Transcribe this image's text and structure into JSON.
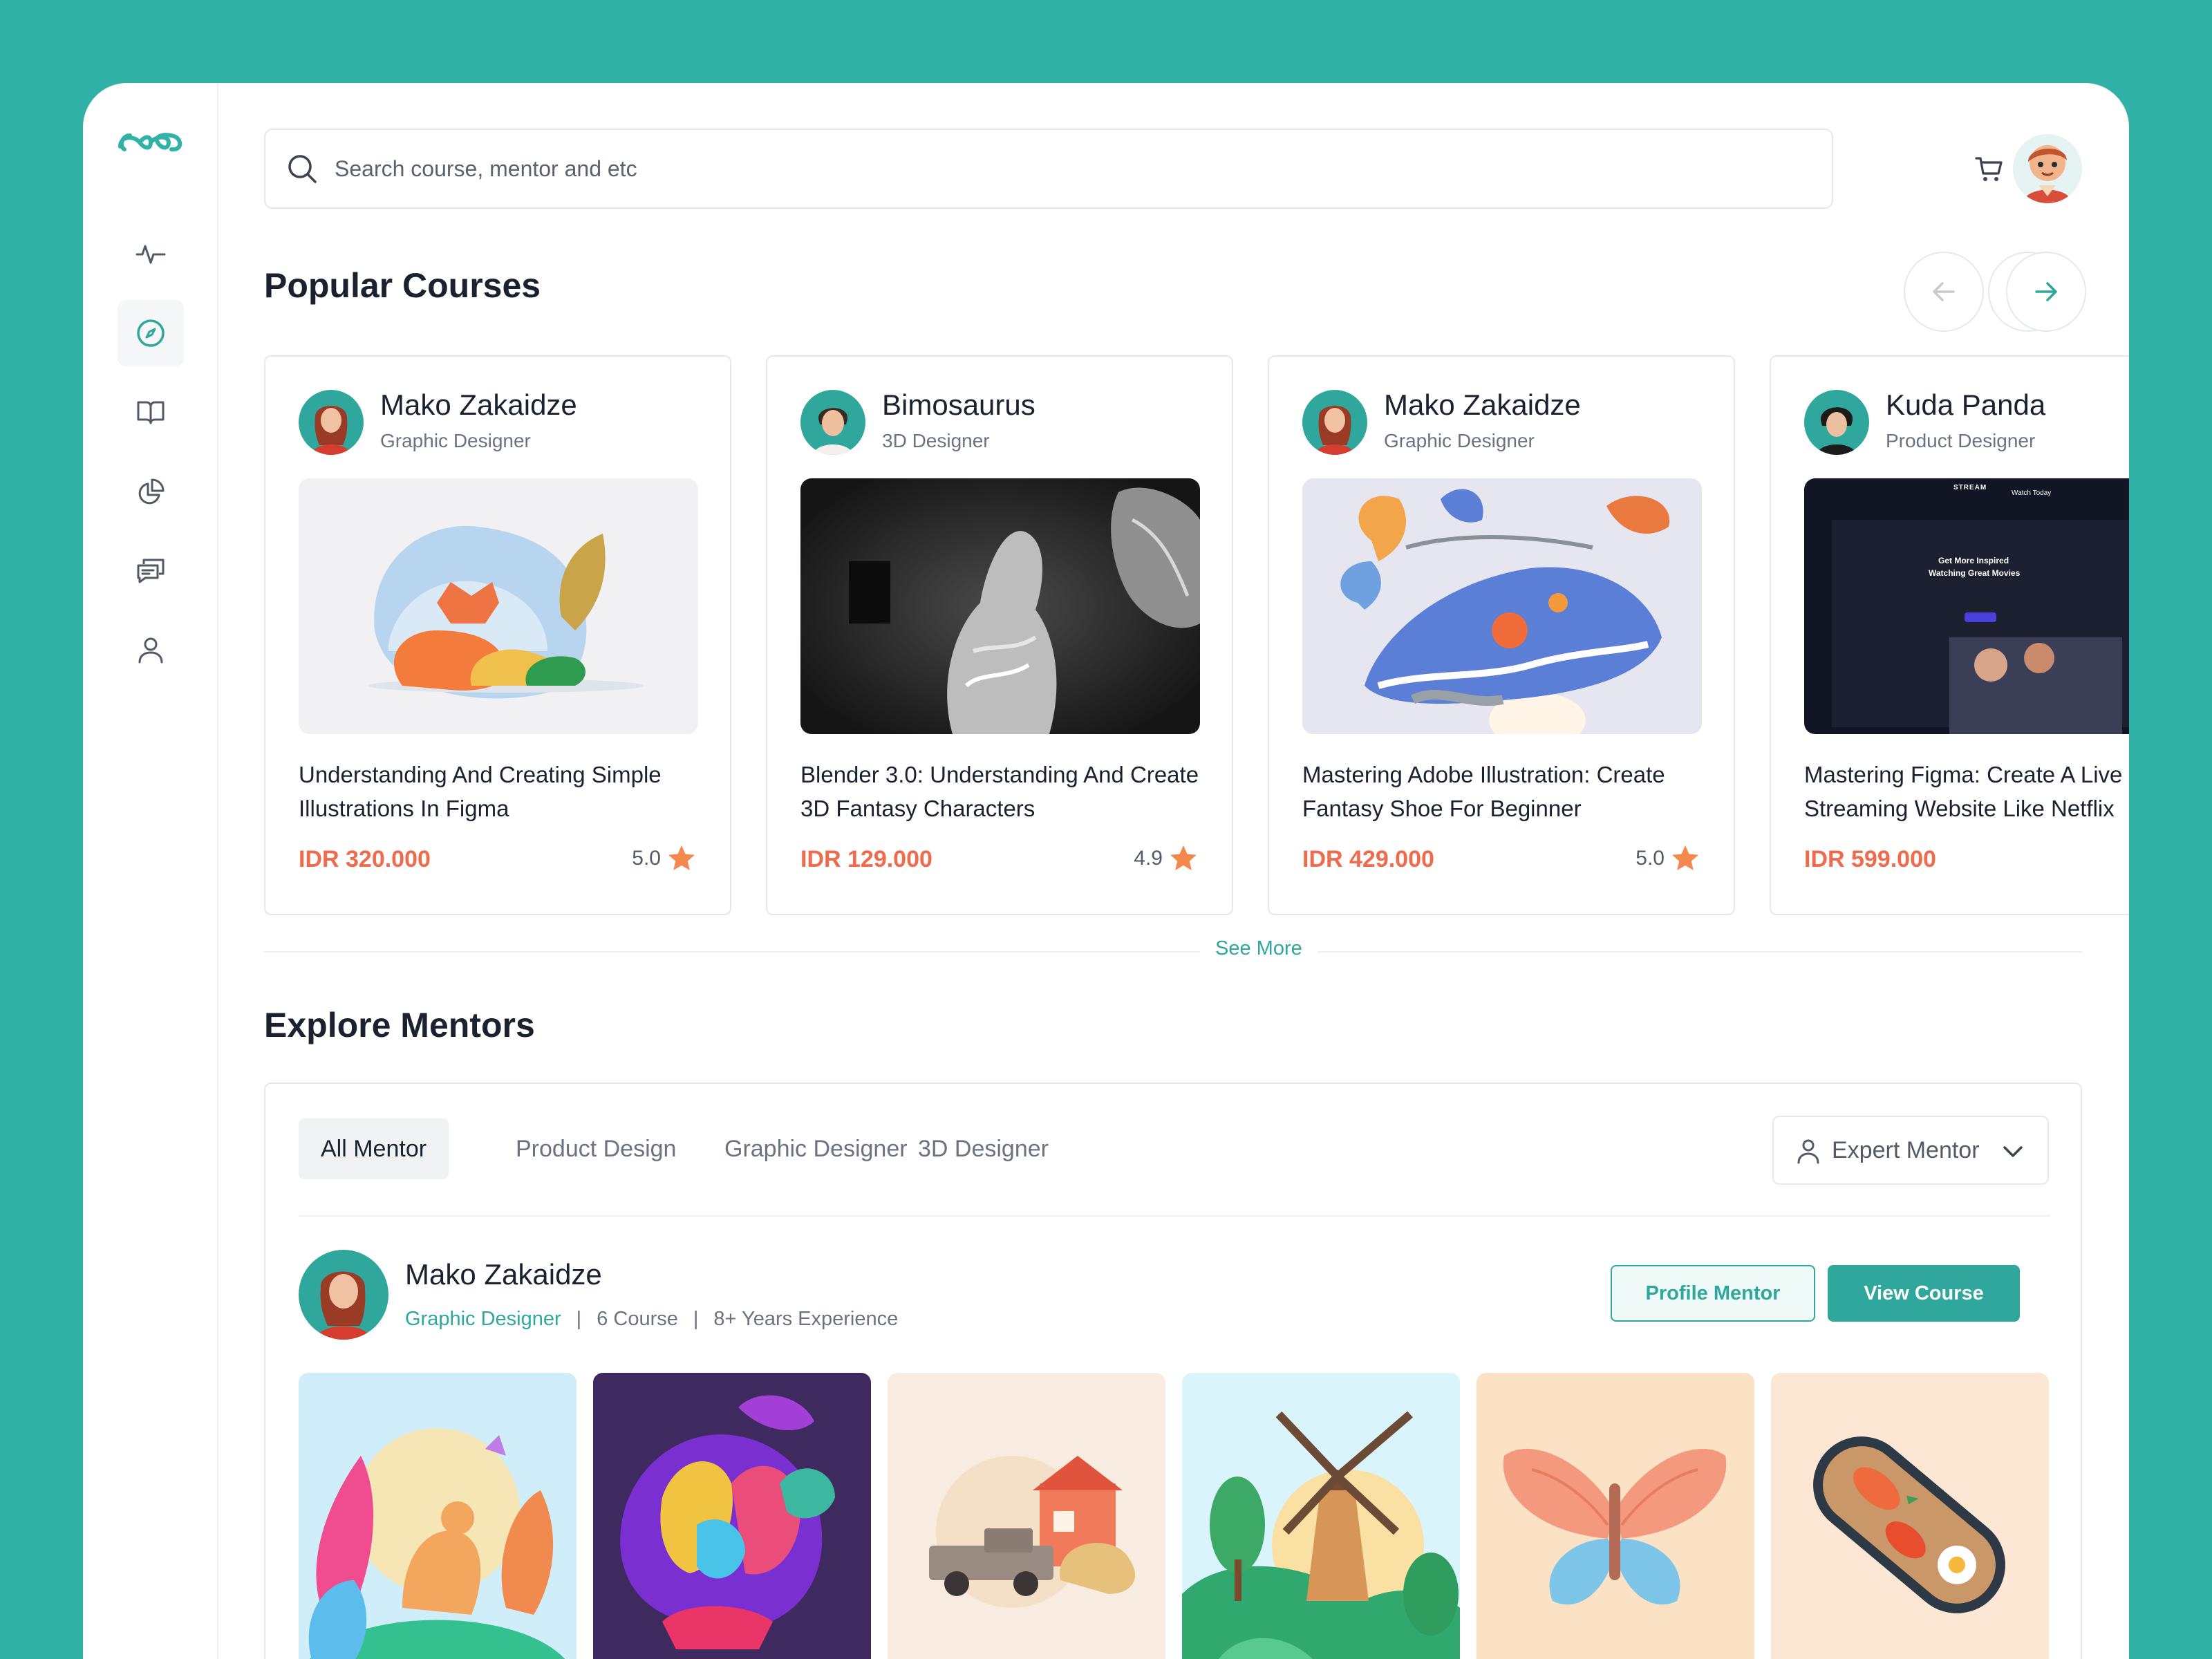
{
  "search": {
    "placeholder": "Search course, mentor and etc"
  },
  "icons": {
    "logo": "infinity-logo-icon",
    "sidebar": [
      "activity-icon",
      "compass-icon",
      "book-icon",
      "pie-chart-icon",
      "messages-icon",
      "user-icon"
    ],
    "header": [
      "cart-icon",
      "bell-icon"
    ]
  },
  "colors": {
    "accent": "#2fa79c",
    "background": "#30b2a7",
    "price": "#ef6b4e",
    "star": "#f3894f"
  },
  "popular": {
    "title": "Popular Courses",
    "courses": [
      {
        "mentor": "Mako Zakaidze",
        "role": "Graphic Designer",
        "title": "Understanding And Creating Simple Illustrations In Figma",
        "price": "IDR 320.000",
        "rating": "5.0"
      },
      {
        "mentor": "Bimosaurus",
        "role": "3D Designer",
        "title": "Blender 3.0: Understanding And Create 3D Fantasy Characters",
        "price": "IDR 129.000",
        "rating": "4.9"
      },
      {
        "mentor": "Mako Zakaidze",
        "role": "Graphic Designer",
        "title": "Mastering Adobe Illustration: Create Fantasy Shoe For Beginner",
        "price": "IDR 429.000",
        "rating": "5.0"
      },
      {
        "mentor": "Kuda Panda",
        "role": "Product Designer",
        "title": "Mastering Figma: Create A Live Streaming Website Like Netflix",
        "price": "IDR 599.000",
        "rating": ""
      }
    ],
    "thumb4": {
      "brand": "STREAM",
      "watch": "Watch Today",
      "headline1": "Get More Inspired",
      "headline2": "Watching Great Movies"
    },
    "see_more": "See More"
  },
  "mentors": {
    "title": "Explore Mentors",
    "tabs": [
      "All Mentor",
      "Product Design",
      "Graphic Designer",
      "3D Designer"
    ],
    "dropdown": "Expert Mentor",
    "featured": {
      "name": "Mako Zakaidze",
      "role": "Graphic Designer",
      "courses": "6 Course",
      "experience": "8+ Years Experience",
      "profile_button": "Profile Mentor",
      "view_button": "View Course"
    }
  }
}
